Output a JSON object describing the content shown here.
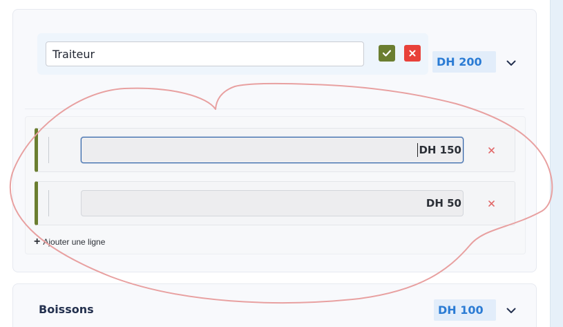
{
  "categories": [
    {
      "name": "Traiteur",
      "total": "DH 200",
      "lines": [
        {
          "amount": "DH 150"
        },
        {
          "amount": "DH 50"
        }
      ],
      "add_line_label": "Ajouter une ligne"
    },
    {
      "name": "Boissons",
      "total": "DH 100"
    }
  ],
  "icons": {
    "confirm": "check-icon",
    "cancel": "close-icon",
    "expand": "chevron-down-icon",
    "remove_line": "close-icon",
    "add": "plus-icon"
  },
  "colors": {
    "confirm": "#6b7e30",
    "cancel": "#e8413a",
    "total_text": "#2a7bd4",
    "line_accent": "#6b7e30",
    "remove_x": "#e26a6a",
    "annotation": "#e8a0a0"
  }
}
